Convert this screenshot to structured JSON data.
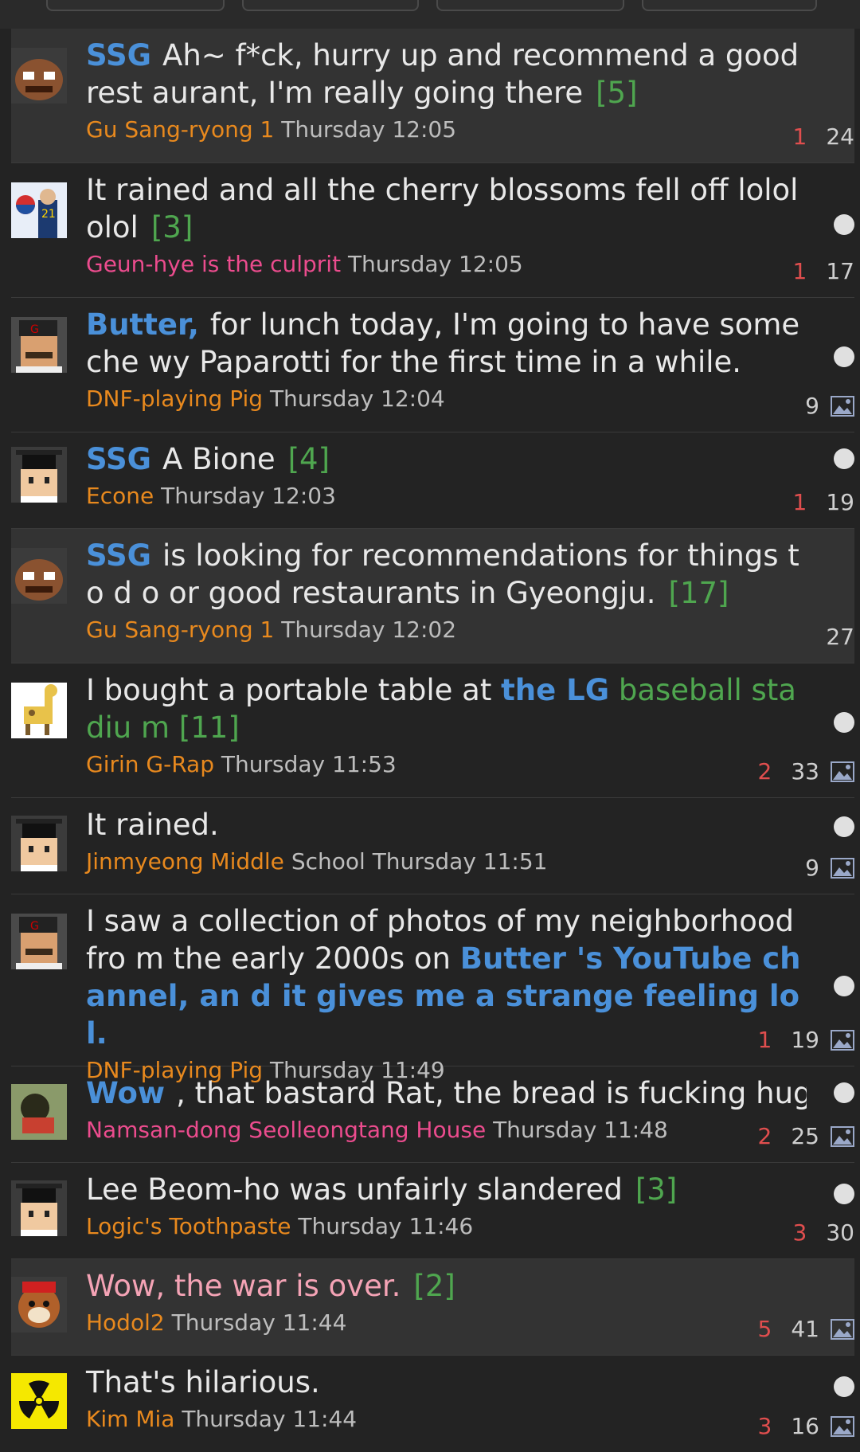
{
  "posts": [
    {
      "tag": "SSG",
      "title": "Ah~ f*ck, hurry up and recommend a good rest aurant, I'm really going there",
      "count": "[5]",
      "author": "Gu Sang-ryong 1",
      "time": "Thursday 12:05",
      "likes": "1",
      "views": "24",
      "has_dot": false,
      "has_image": false,
      "highlight": true,
      "avatar_icon": "goomba-avatar-icon"
    },
    {
      "tag": "",
      "title": "It rained and all the cherry blossoms fell off lolololol",
      "count": "[3]",
      "author": "Geun-hye is the culprit",
      "time": "Thursday 12:05",
      "likes": "1",
      "views": "17",
      "has_dot": true,
      "has_image": false,
      "highlight": false,
      "avatar_icon": "flag-portrait-avatar-icon"
    },
    {
      "tag": "Butter,",
      "title": "for lunch today, I'm going to have some che wy Paparotti for the first time in a while.",
      "count": "",
      "author": "DNF-playing Pig",
      "time": "Thursday 12:04",
      "likes": "",
      "views": "9",
      "has_dot": true,
      "has_image": true,
      "highlight": false,
      "avatar_icon": "mustache-man-avatar-icon"
    },
    {
      "tag": "SSG",
      "title": "A Bione",
      "count": "[4]",
      "author": "Econe",
      "time": "Thursday 12:03",
      "likes": "1",
      "views": "19",
      "has_dot": true,
      "has_image": false,
      "highlight": false,
      "avatar_icon": "pixel-student-avatar-icon"
    },
    {
      "tag": "SSG",
      "title": "is looking for recommendations for things to d o or good restaurants in Gyeongju.",
      "count": "[17]",
      "author": "Gu Sang-ryong 1",
      "time": "Thursday 12:02",
      "likes": "",
      "views": "27",
      "has_dot": false,
      "has_image": false,
      "highlight": true,
      "avatar_icon": "goomba-avatar-icon"
    },
    {
      "tag": "",
      "title_parts": {
        "a": "I bought a portable table at ",
        "b": "the LG",
        "c": "baseball stadiu m",
        "d": "[11]"
      },
      "author": "Girin G-Rap",
      "time": "Thursday 11:53",
      "likes": "2",
      "views": "33",
      "has_dot": true,
      "has_image": true,
      "highlight": false,
      "avatar_icon": "giraffe-avatar-icon"
    },
    {
      "tag": "",
      "title": "It rained.",
      "count": "",
      "author": "Jinmyeong Middle",
      "author_tail": "School",
      "time": "Thursday 11:51",
      "likes": "",
      "views": "9",
      "has_dot": true,
      "has_image": true,
      "highlight": false,
      "avatar_icon": "pixel-student-avatar-icon"
    },
    {
      "tag": "",
      "title_parts": {
        "a": "I saw a collection of photos of my neighborhood fro m the early 2000s on ",
        "b": "Butter 's YouTube channel, an d it gives me a strange feeling lol."
      },
      "author": "DNF-playing Pig",
      "time": "Thursday 11:49",
      "likes": "1",
      "views": "19",
      "has_dot": true,
      "has_image": true,
      "highlight": false,
      "avatar_icon": "mustache-man-avatar-icon"
    },
    {
      "tag": "Wow",
      "title": ", that bastard Rat, the bread is fucking huge lol",
      "count": "",
      "author": "Namsan-dong Seolleongtang House",
      "time": "Thursday 11:48",
      "likes": "2",
      "views": "25",
      "has_dot": true,
      "has_image": true,
      "highlight": false,
      "avatar_icon": "blurred-photo-avatar-icon"
    },
    {
      "tag": "",
      "title": "Lee Beom-ho was unfairly slandered",
      "count": "[3]",
      "author": "Logic's Toothpaste",
      "time": "Thursday 11:46",
      "likes": "3",
      "views": "30",
      "has_dot": true,
      "has_image": false,
      "highlight": false,
      "avatar_icon": "pixel-student-avatar-icon"
    },
    {
      "tag": "",
      "title": "Wow, the war is over.",
      "count": "[2]",
      "author": "Hodol2",
      "time": "Thursday 11:44",
      "likes": "5",
      "views": "41",
      "has_dot": false,
      "has_image": true,
      "highlight": true,
      "avatar_icon": "tiger-mascot-avatar-icon",
      "title_color": "pink"
    },
    {
      "tag": "",
      "title": "That's hilarious.",
      "count": "",
      "author": "Kim Mia",
      "time": "Thursday 11:44",
      "likes": "3",
      "views": "16",
      "has_dot": true,
      "has_image": true,
      "highlight": false,
      "avatar_icon": "radiation-avatar-icon"
    }
  ],
  "colors": {
    "background": "#232323",
    "highlight": "#333333",
    "tag": "#4a90d9",
    "count": "#4fa64f",
    "author": "#e8891e",
    "author_pink": "#ec4c8e",
    "likes": "#e04e4e"
  }
}
